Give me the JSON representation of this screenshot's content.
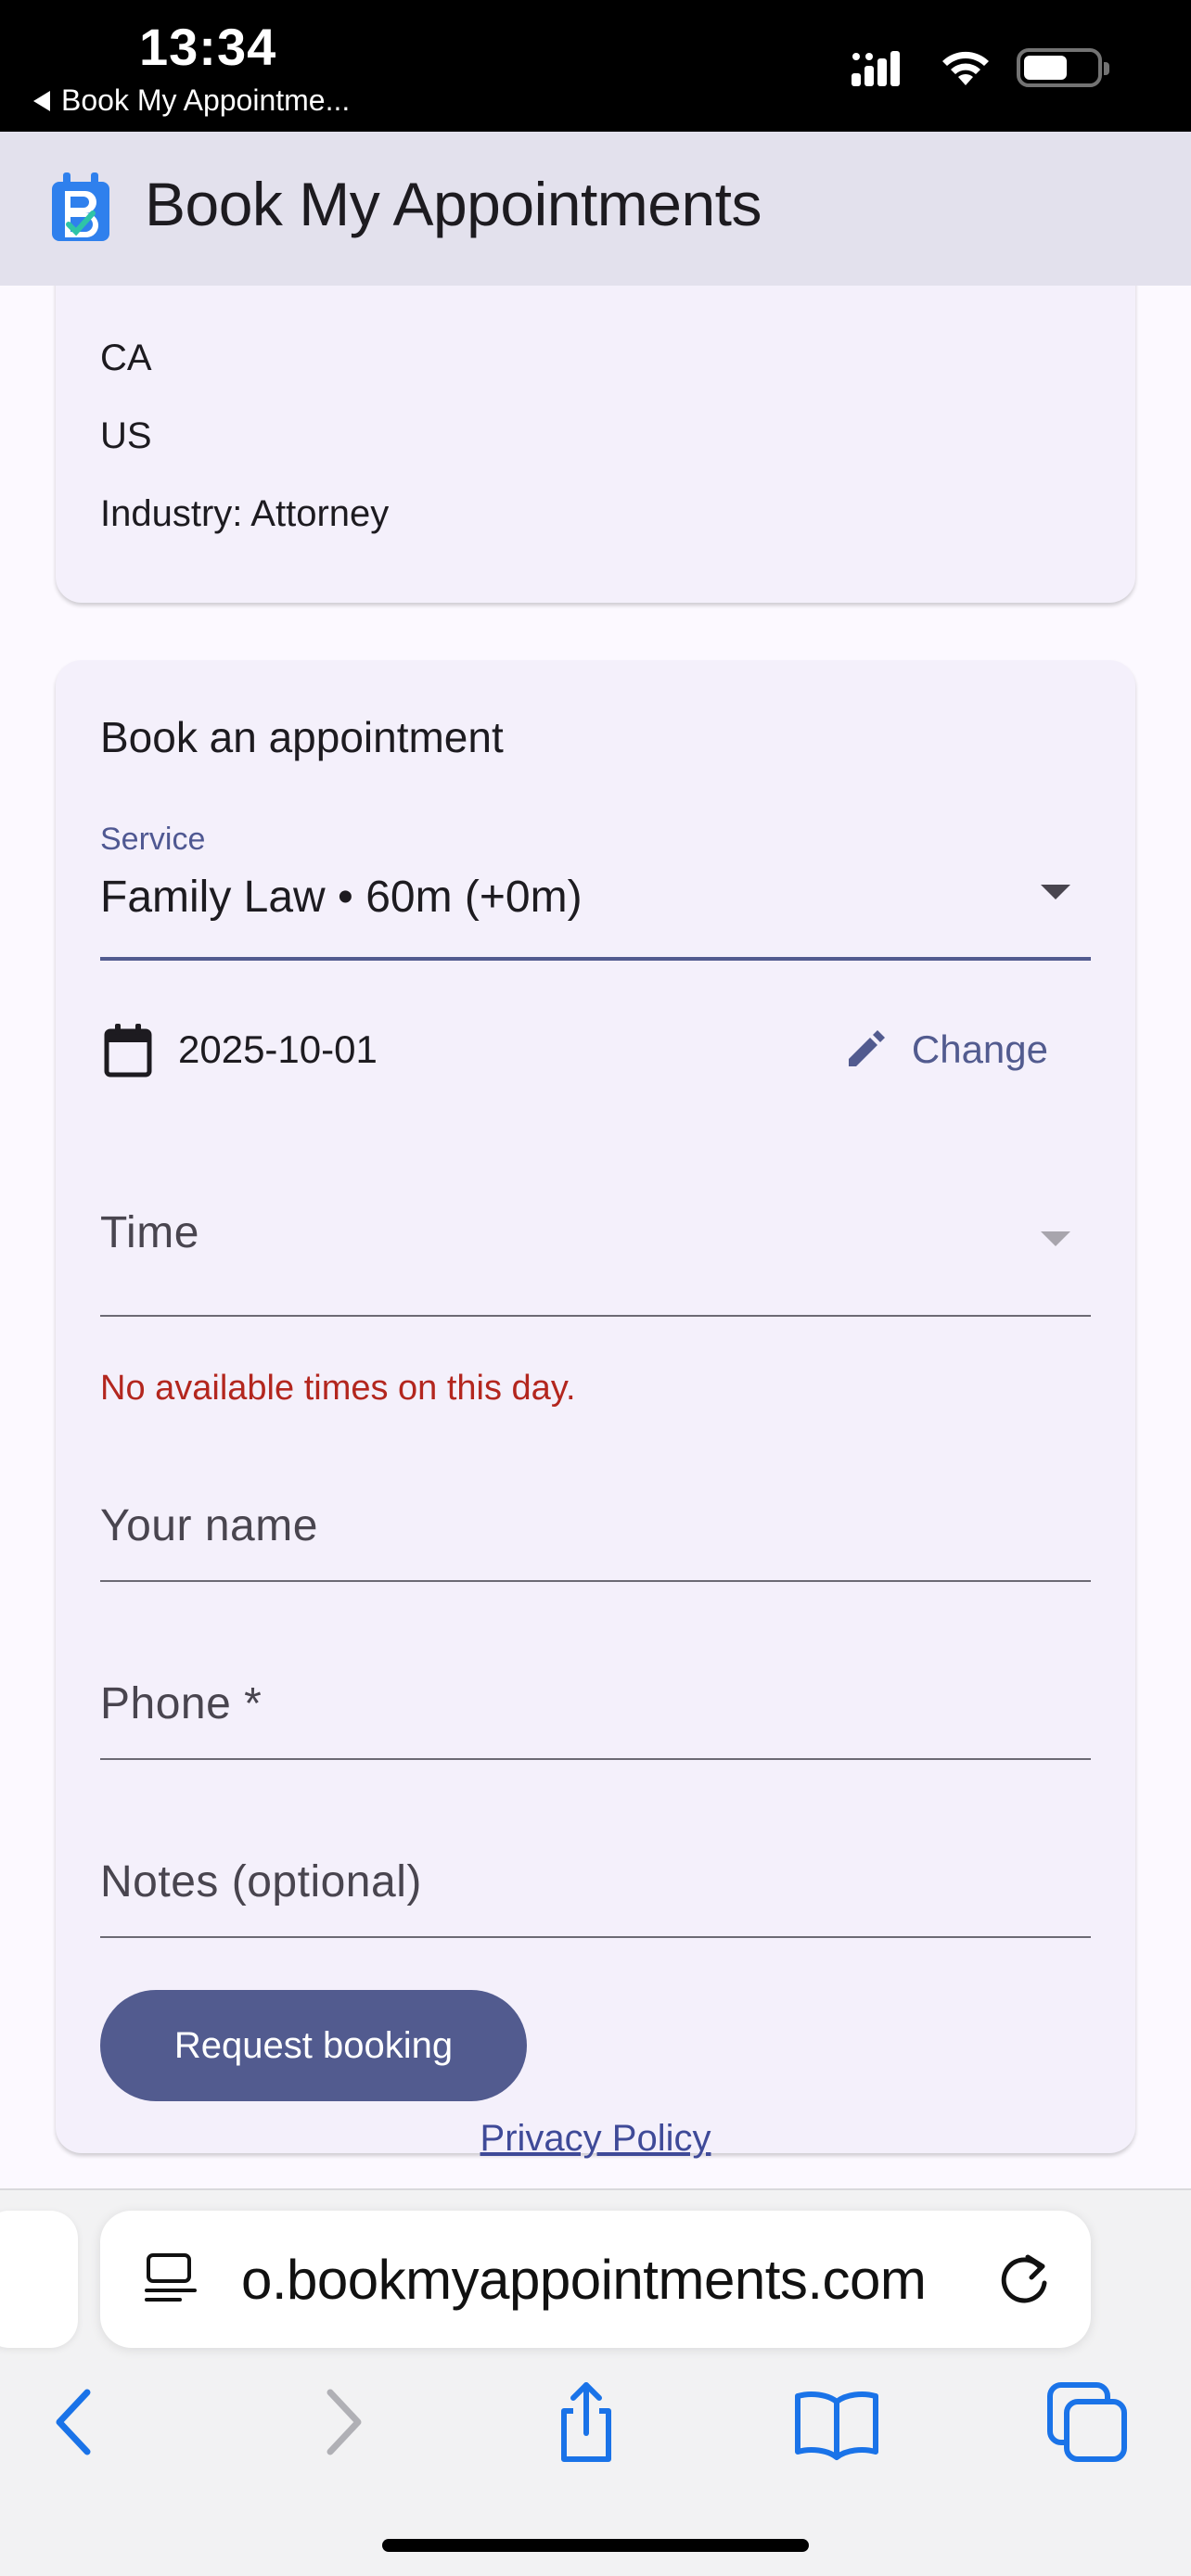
{
  "status_bar": {
    "time": "13:34",
    "back_app": "Book My Appointme...",
    "icons": [
      "cellular-signal-icon",
      "wifi-icon",
      "battery-icon"
    ],
    "battery_level": 0.6
  },
  "app_bar": {
    "title": "Book My Appointments",
    "logo": "calendar-check-logo"
  },
  "business_card": {
    "lines": [
      "CA",
      "US",
      "Industry: Attorney"
    ]
  },
  "booking_form": {
    "heading": "Book an appointment",
    "service": {
      "label": "Service",
      "value": "Family Law • 60m (+0m)"
    },
    "date": {
      "value": "2025-10-01",
      "change_label": "Change"
    },
    "time": {
      "placeholder": "Time",
      "error": "No available times on this day."
    },
    "name_placeholder": "Your name",
    "phone_placeholder": "Phone *",
    "notes_placeholder": "Notes (optional)",
    "submit_label": "Request booking",
    "privacy_link": "Privacy Policy"
  },
  "safari": {
    "url_display": "o.bookmyappointments.com",
    "toolbar_icons": [
      "back-icon",
      "forward-icon",
      "share-icon",
      "bookmarks-icon",
      "tabs-icon"
    ]
  },
  "colors": {
    "primary": "#525b8f",
    "error": "#b3261e",
    "app_bar": "#e3e1ed",
    "card": "#f4f0fb",
    "safari_blue": "#1a73e8"
  }
}
